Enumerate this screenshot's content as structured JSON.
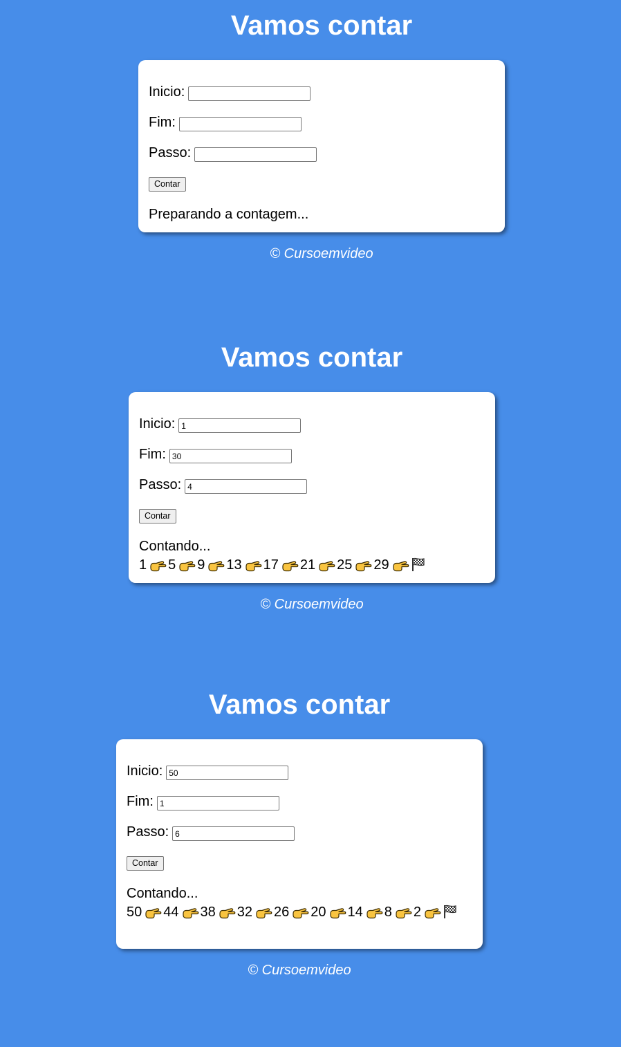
{
  "panels": [
    {
      "title": "Vamos contar",
      "fields": [
        {
          "label": "Inicio:",
          "value": ""
        },
        {
          "label": "Fim:",
          "value": ""
        },
        {
          "label": "Passo:",
          "value": ""
        }
      ],
      "button_label": "Contar",
      "result_header": "Preparando a contagem...",
      "sequence": [],
      "footer": "© Cursoemvideo"
    },
    {
      "title": "Vamos contar",
      "fields": [
        {
          "label": "Inicio:",
          "value": "1"
        },
        {
          "label": "Fim:",
          "value": "30"
        },
        {
          "label": "Passo:",
          "value": "4"
        }
      ],
      "button_label": "Contar",
      "result_header": "Contando...",
      "sequence": [
        "1",
        "5",
        "9",
        "13",
        "17",
        "21",
        "25",
        "29"
      ],
      "footer": "© Cursoemvideo"
    },
    {
      "title": "Vamos contar",
      "fields": [
        {
          "label": "Inicio:",
          "value": "50"
        },
        {
          "label": "Fim:",
          "value": "1"
        },
        {
          "label": "Passo:",
          "value": "6"
        }
      ],
      "button_label": "Contar",
      "result_header": "Contando...",
      "sequence": [
        "50",
        "44",
        "38",
        "32",
        "26",
        "20",
        "14",
        "8",
        "2"
      ],
      "footer": "© Cursoemvideo"
    }
  ],
  "icons": {
    "step": "pointing-hand-icon",
    "end": "checkered-flag-icon"
  },
  "colors": {
    "background": "#478de9",
    "card": "#ffffff",
    "hand": "#f9c440"
  }
}
